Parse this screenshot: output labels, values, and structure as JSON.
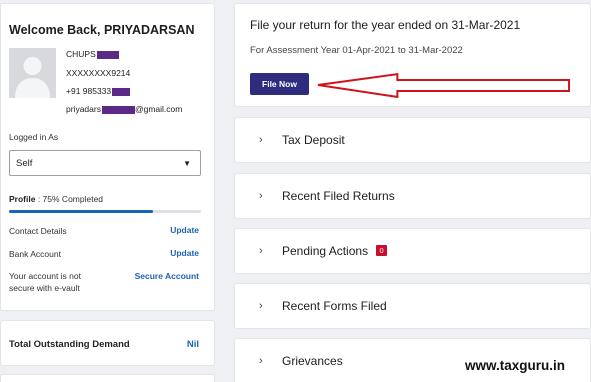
{
  "profile": {
    "welcome": "Welcome Back, PRIYADARSAN",
    "name_prefix": "CHUPS",
    "pan": "XXXXXXXX9214",
    "phone_prefix": "+91 985333",
    "email_prefix": "priyadars",
    "email_suffix": "@gmail.com",
    "logged_in_as_label": "Logged in As",
    "logged_in_as_value": "Self",
    "profile_label": "Profile",
    "profile_status": ": 75% Completed",
    "profile_progress": 0.75,
    "contact_label": "Contact Details",
    "contact_action": "Update",
    "bank_label": "Bank Account",
    "bank_action": "Update",
    "evault_text_1": "Your account is not",
    "evault_text_2": "secure with e-vault",
    "evault_action": "Secure Account"
  },
  "demand": {
    "label": "Total Outstanding Demand",
    "value": "Nil"
  },
  "file_return": {
    "title": "File your return for the year ended on 31-Mar-2021",
    "assessment_year": "For Assessment Year 01-Apr-2021 to 31-Mar-2022",
    "button": "File Now"
  },
  "sections": [
    {
      "label": "Tax Deposit"
    },
    {
      "label": "Recent Filed Returns"
    },
    {
      "label": "Pending Actions",
      "badge": "0"
    },
    {
      "label": "Recent Forms Filed"
    },
    {
      "label": "Grievances"
    }
  ],
  "watermark": "www.taxguru.in",
  "colors": {
    "accent_link": "#1f63b3",
    "primary_button": "#2d2c7f",
    "badge_red": "#c8102e",
    "redaction": "#5b2a86",
    "annotation_arrow": "#d0121b"
  },
  "icons": {
    "avatar": "user-silhouette-icon",
    "dropdown": "caret-down-icon",
    "section_toggle": "chevron-right-icon",
    "annotation": "red-arrow-icon"
  }
}
